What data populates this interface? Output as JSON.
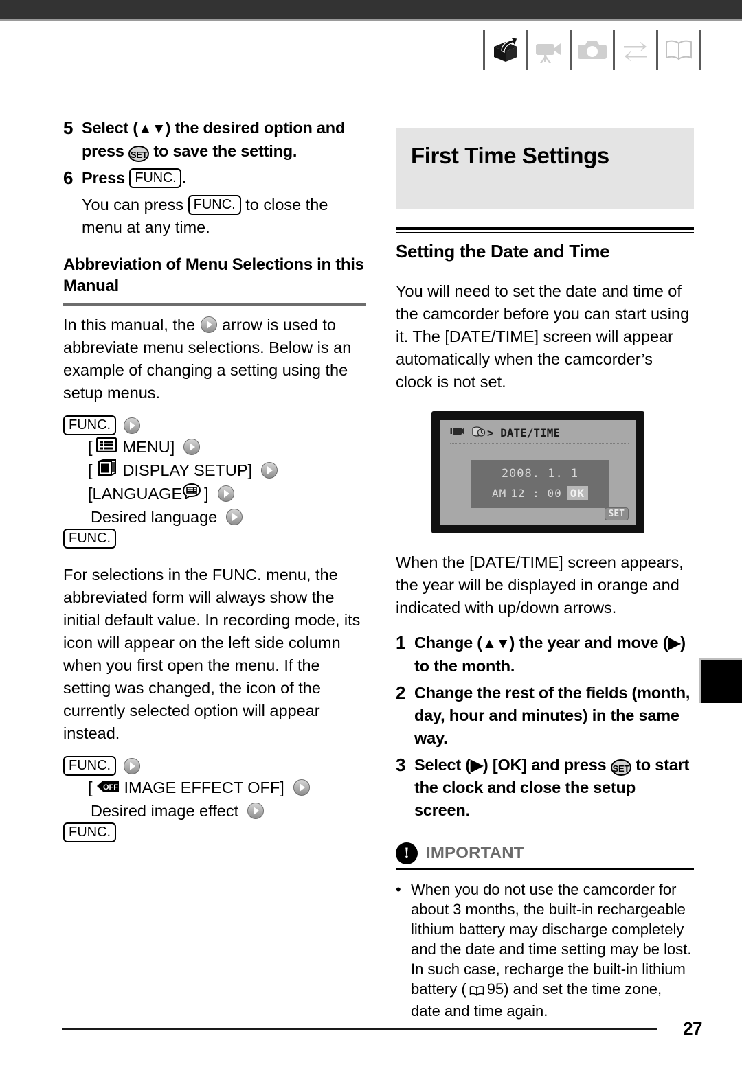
{
  "page": {
    "number": "27"
  },
  "header": {
    "icons": [
      {
        "name": "unpacking-box-icon",
        "label": "Introduction / Unpacking"
      },
      {
        "name": "camcorder-icon",
        "label": "Video"
      },
      {
        "name": "photo-camera-icon",
        "label": "Photos"
      },
      {
        "name": "exchange-arrows-icon",
        "label": "External Connections"
      },
      {
        "name": "open-book-icon",
        "label": "Additional Information"
      }
    ]
  },
  "left": {
    "step5": {
      "num": "5",
      "part1": "Select (",
      "arrows": "▲▼",
      "part2": ") the desired option and press ",
      "set_label": "SET",
      "part3": " to save the setting."
    },
    "step6": {
      "num": "6",
      "part1": "Press ",
      "func_label": "FUNC.",
      "part2": ".",
      "note1": "You can press ",
      "note_func_label": "FUNC.",
      "note2": " to close the menu at any time."
    },
    "section_title": "Abbreviation of Menu Selections in this Manual",
    "intro_part1": "In this manual, the ",
    "intro_part2": " arrow is used to abbreviate menu selections. Below is an example of changing a setting using the setup menus.",
    "flow1": {
      "start": "FUNC.",
      "rows": [
        {
          "prefix": "[",
          "icon": "menu-list-icon",
          "text": "MENU]",
          "arrow": true
        },
        {
          "prefix": "[",
          "icon": "display-monitor-icon",
          "text": "DISPLAY SETUP]",
          "arrow": true
        },
        {
          "prefix": "[LANGUAGE",
          "icon": "speech-bubble-icon",
          "text": "]",
          "arrow": true
        },
        {
          "prefix": "",
          "icon": "",
          "text": "Desired language",
          "arrow": true
        }
      ],
      "end": "FUNC."
    },
    "body_para": "For selections in the FUNC. menu, the abbreviated form will always show the initial default value. In recording mode, its icon will appear on the left side column when you first open the menu. If the setting was changed, the icon of the currently selected option will appear instead.",
    "flow2": {
      "start": "FUNC.",
      "rows": [
        {
          "prefix": "[",
          "icon": "image-effect-off-icon",
          "text": "IMAGE EFFECT OFF]",
          "arrow": true
        },
        {
          "prefix": "",
          "icon": "",
          "text": "Desired image effect",
          "arrow": true
        }
      ],
      "end": "FUNC."
    }
  },
  "right": {
    "banner_title": "First Time Settings",
    "sub_head": "Setting the Date and Time",
    "intro": "You will need to set the date and time of the camcorder before you can start using it. The [DATE/TIME] screen will appear automatically when the camcorder’s clock is not set.",
    "lcd": {
      "title": "> DATE/TIME",
      "date": "2008. 1. 1",
      "ampm": "AM",
      "time": "12 : 00",
      "ok_label": "OK",
      "set_label": "SET"
    },
    "after_lcd": "When the [DATE/TIME] screen appears, the year will be displayed in orange and indicated with up/down arrows.",
    "steps": [
      {
        "num": "1",
        "part1": "Change (",
        "arrows": "▲▼",
        "part2": ") the year and move (",
        "arrow2": "▶",
        "part3": ") to the month."
      },
      {
        "num": "2",
        "text": "Change the rest of the fields (month, day, hour and minutes) in the same way."
      },
      {
        "num": "3",
        "part1": "Select (",
        "arrow2": "▶",
        "part2": ") [OK] and press ",
        "set_label": "SET",
        "part3": " to start the clock and close the setup screen."
      }
    ],
    "important": {
      "mark": "!",
      "label": "IMPORTANT",
      "bullet": "•",
      "text_part1": "When you do not use the camcorder for about 3 months, the built-in rechargeable lithium battery may discharge completely and the date and time setting may be lost. In such case, recharge the built-in lithium battery (",
      "ref_page": "95",
      "text_part2": ") and set the time zone, date and time again."
    }
  }
}
